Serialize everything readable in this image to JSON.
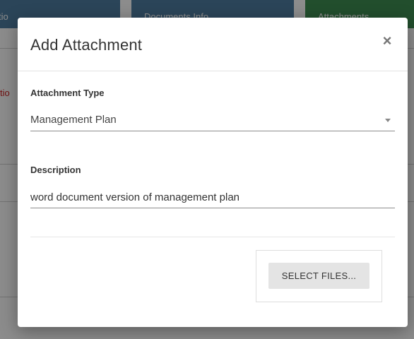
{
  "background": {
    "tabs": [
      "tio",
      "Documents Info",
      "Attachments"
    ],
    "red_fragment": "tio"
  },
  "modal": {
    "title": "Add Attachment",
    "close_label": "×",
    "attachment_type": {
      "label": "Attachment Type",
      "selected": "Management Plan"
    },
    "description": {
      "label": "Description",
      "value": "word document version of management plan"
    },
    "select_files_label": "SELECT FILES..."
  }
}
